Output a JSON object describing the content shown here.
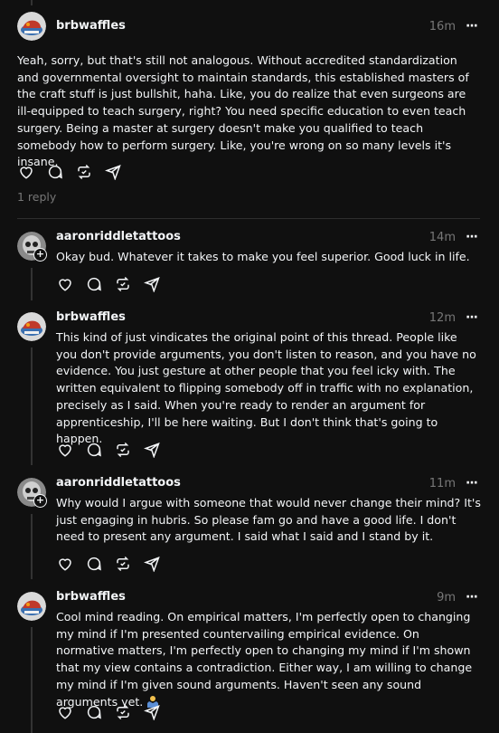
{
  "post": {
    "username": "brbwaffles",
    "time": "16m",
    "more_icon": "ellipsis-icon",
    "text": "Yeah, sorry, but that's still not analogous. Without accredited standardization and governmental oversight to maintain standards, this established masters of the craft stuff is just bullshit, haha. Like, you do realize that even surgeons are ill-equipped to teach surgery, right? You need specific education to even teach surgery. Being a master at surgery doesn't make you qualified to teach somebody how to perform surgery. Like, you're wrong on so many levels it's insane.",
    "reply_count": "1 reply"
  },
  "replies": [
    {
      "username": "aaronriddletattoos",
      "time": "14m",
      "text": "Okay bud. Whatever it takes to make you feel superior. Good luck in life."
    },
    {
      "username": "brbwaffles",
      "time": "12m",
      "text": "This kind of just vindicates the original point of this thread. People like you don't provide arguments, you don't listen to reason, and you have no evidence. You just gesture at other people that you feel icky with. The written equivalent to flipping somebody off in traffic with no explanation, precisely as I said. When you're ready to render an argument for apprenticeship, I'll be here waiting. But I don't think that's going to happen."
    },
    {
      "username": "aaronriddletattoos",
      "time": "11m",
      "text": "Why would I argue with someone that would never change their mind? It's just engaging in hubris. So please fam go and have a good life. I don't need to present any argument. I said what I said and I stand by it."
    },
    {
      "username": "brbwaffles",
      "time": "9m",
      "text": "Cool mind reading. On empirical matters, I'm perfectly open to changing my mind if I'm presented countervailing empirical evidence. On normative matters, I'm perfectly open to changing my mind if I'm shown that my view contains a contradiction. Either way, I am willing to change my mind if I'm given sound arguments. Haven't seen any sound arguments yet.",
      "emoji_icon": "person-shrugging-emoji"
    }
  ],
  "actions": [
    "heart-icon",
    "comment-icon",
    "repost-icon",
    "share-icon"
  ],
  "colors": {
    "background": "#101010",
    "text": "#f3f5f7",
    "muted": "#777777",
    "divider": "#2e2e2e"
  }
}
